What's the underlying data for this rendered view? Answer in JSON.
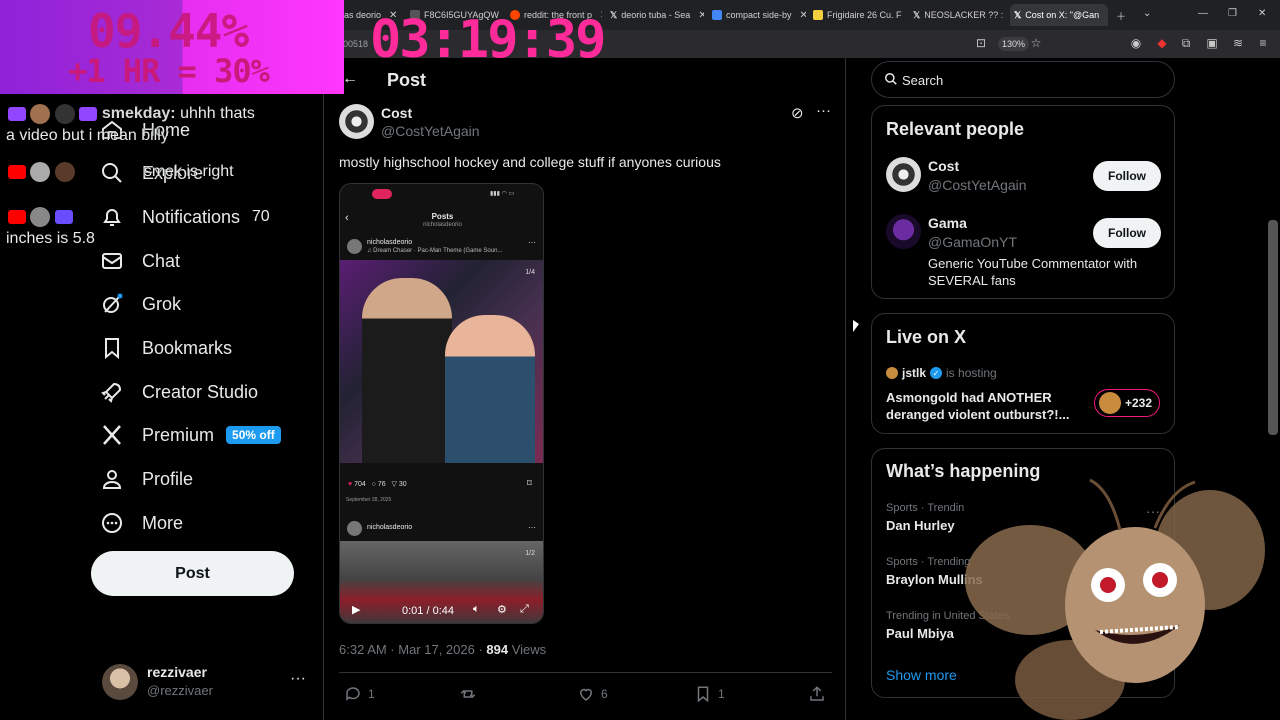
{
  "browser": {
    "tabs": [
      {
        "label": "as deorio",
        "color": "#555555"
      },
      {
        "label": "F8C6I5GUYAgQW",
        "color": "#444444"
      },
      {
        "label": "reddit: the front p",
        "color": "#ff4500"
      },
      {
        "label": "deorio tuba - Sea",
        "color": "#eeeeee"
      },
      {
        "label": "compact side-by",
        "color": "#4285f4"
      },
      {
        "label": "Frigidaire 26 Cu. F",
        "color": "#f4d03f"
      },
      {
        "label": "NEOSLACKER ?? :",
        "color": "#eeeeee"
      },
      {
        "label": "Cost on X: \"@Gan",
        "color": "#eeeeee"
      }
    ],
    "url_fragment": "00518",
    "zoom": "130%"
  },
  "overlay": {
    "percent": "09.44%",
    "bonus": "+1 HR = 30%",
    "timer": "03:19:39"
  },
  "chat": [
    {
      "user": "smekday:",
      "message": "uhhh thats",
      "wrap": "a video but i mean billy"
    },
    {
      "user": "",
      "message": "smek is right"
    },
    {
      "user": "",
      "message": "70",
      "wrap": "inches is 5.8"
    }
  ],
  "nav": {
    "items": [
      {
        "label": "Home",
        "icon": "home-icon"
      },
      {
        "label": "Explore",
        "icon": "search-icon"
      },
      {
        "label": "Notifications",
        "icon": "bell-icon"
      },
      {
        "label": "Chat",
        "icon": "mail-icon"
      },
      {
        "label": "Grok",
        "icon": "grok-icon"
      },
      {
        "label": "Bookmarks",
        "icon": "bookmark-icon"
      },
      {
        "label": "Creator Studio",
        "icon": "rocket-icon"
      },
      {
        "label": "Premium",
        "icon": "x-logo-icon"
      },
      {
        "label": "Profile",
        "icon": "person-icon"
      },
      {
        "label": "More",
        "icon": "more-circle-icon"
      }
    ],
    "premium_badge": "50% off",
    "post_button": "Post"
  },
  "account": {
    "name": "rezzivaer",
    "handle": "@rezzivaer"
  },
  "post": {
    "header_title": "Post",
    "author_name": "Cost",
    "author_handle": "@CostYetAgain",
    "text": "mostly highschool hockey and college stuff if anyones curious",
    "embedded": {
      "title": "Posts",
      "subtitle": "nicholasdeorio",
      "user": "nicholasdeorio",
      "song": "♫ Dream Chaser · Pac-Man Theme (Game Soun...",
      "photo_count": "1/4",
      "likes": "704",
      "comments": "76",
      "shares": "30",
      "date": "September 28, 2025",
      "user2": "nicholasdeorio",
      "photo_count2": "1/2"
    },
    "video_time": "0:01 / 0:44",
    "timestamp": "6:32 AM · Mar 17, 2026 · ",
    "views_count": "894",
    "views_label": " Views",
    "replies": "1",
    "retweets": "",
    "likes": "6",
    "bookmarks": "1"
  },
  "sidebar": {
    "search_placeholder": "Search",
    "relevant_title": "Relevant people",
    "people": [
      {
        "name": "Cost",
        "handle": "@CostYetAgain",
        "bio": "",
        "follow": "Follow"
      },
      {
        "name": "Gama",
        "handle": "@GamaOnYT",
        "bio": "Generic YouTube Commentator with SEVERAL fans",
        "follow": "Follow"
      }
    ],
    "live_title": "Live on X",
    "live_host": "jstlk",
    "live_hosting": "is hosting",
    "live_stream_title": "Asmongold had ANOTHER deranged violent outburst?!...",
    "live_listeners": "+232",
    "happening_title": "What’s happening",
    "trends": [
      {
        "sub": "Sports · Trendin",
        "name": "Dan Hurley"
      },
      {
        "sub": "Sports · Trending",
        "name": "Braylon Mullins"
      },
      {
        "sub": "Trending in United States",
        "name": "Paul Mbiya"
      }
    ],
    "show_more": "Show more"
  }
}
